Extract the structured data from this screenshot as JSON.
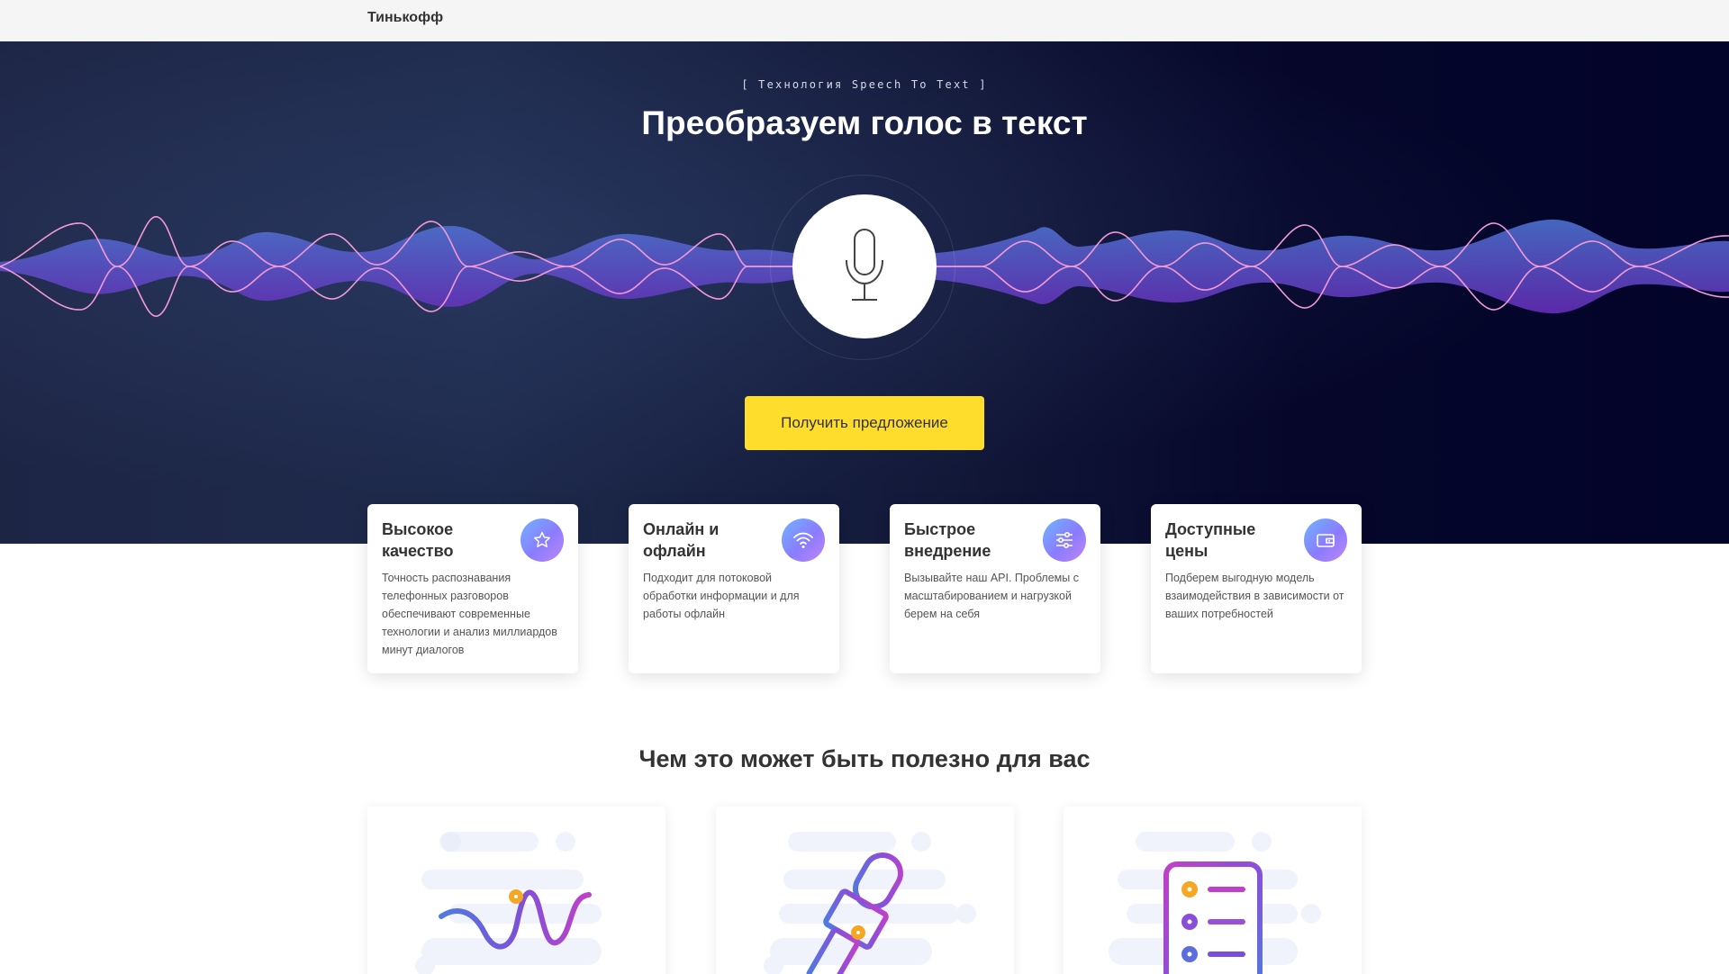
{
  "header": {
    "brand": "Тинькофф"
  },
  "hero": {
    "kicker": "[ Технология Speech To Text ]",
    "title": "Преобразуем голос в текст",
    "cta_label": "Получить предложение"
  },
  "features": [
    {
      "title": "Высокое качество",
      "text": "Точность распознавания телефонных разговоров обеспечивают современные технологии и анализ миллиардов минут диалогов",
      "icon": "star-icon"
    },
    {
      "title": "Онлайн и офлайн",
      "text": "Подходит для потоковой обработки информации и для работы офлайн",
      "icon": "wifi-icon"
    },
    {
      "title": "Быстрое внедрение",
      "text": "Вызывайте наш API. Проблемы с масштабированием и нагрузкой берем на себя",
      "icon": "sliders-icon"
    },
    {
      "title": "Доступные цены",
      "text": "Подберем выгодную модель взаимодействия в зависимости от ваших потребностей",
      "icon": "wallet-icon"
    }
  ],
  "benefits": {
    "title": "Чем это может быть полезно для вас"
  },
  "colors": {
    "cta": "#ffdd2d",
    "hero_dark": "#05062a",
    "accent_purple": "#8a5cf6",
    "accent_orange": "#f5a623"
  }
}
